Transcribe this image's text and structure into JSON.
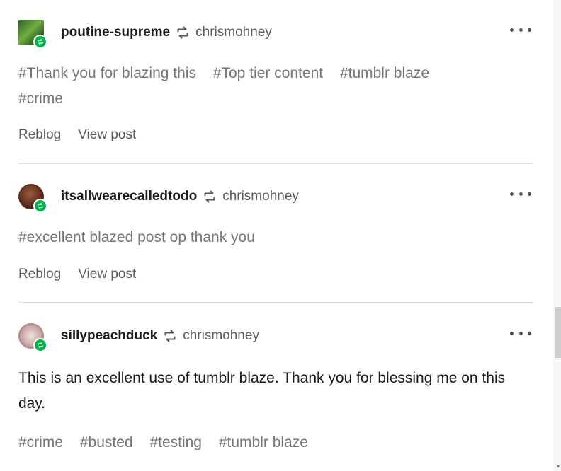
{
  "notes": [
    {
      "blog": "poutine-supreme",
      "source": "chrismohney",
      "tags": [
        "#Thank you for blazing this",
        "#Top tier content",
        "#tumblr blaze",
        "#crime"
      ],
      "actions": {
        "reblog": "Reblog",
        "view": "View post"
      }
    },
    {
      "blog": "itsallwearecalledtodo",
      "source": "chrismohney",
      "tags": [
        "#excellent blazed post op thank you"
      ],
      "actions": {
        "reblog": "Reblog",
        "view": "View post"
      }
    },
    {
      "blog": "sillypeachduck",
      "source": "chrismohney",
      "body": "This is an excellent use of tumblr blaze. Thank you for blessing me on this day.",
      "tags": [
        "#crime",
        "#busted",
        "#testing",
        "#tumblr blaze"
      ]
    }
  ],
  "colors": {
    "reblog_green": "#00b34a",
    "text": "#1a1a1a",
    "muted": "#767676"
  },
  "icons": {
    "reblog": "reblog-icon",
    "more": "ellipsis-icon"
  }
}
